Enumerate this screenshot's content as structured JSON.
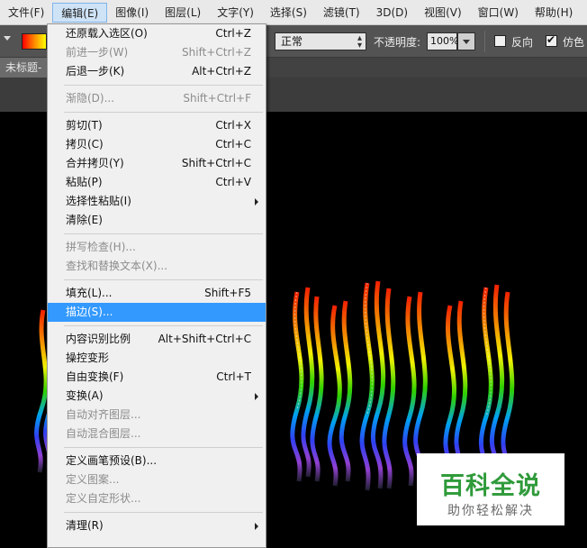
{
  "menubar": {
    "items": [
      "文件(F)",
      "编辑(E)",
      "图像(I)",
      "图层(L)",
      "文字(Y)",
      "选择(S)",
      "滤镜(T)",
      "3D(D)",
      "视图(V)",
      "窗口(W)",
      "帮助(H)"
    ],
    "active_index": 1
  },
  "options": {
    "mode_value": "正常",
    "opacity_label": "不透明度:",
    "opacity_value": "100%",
    "reverse_label": "反向",
    "reverse_checked": false,
    "dither_label": "仿色",
    "dither_checked": true
  },
  "doc_tab": {
    "title": "未标题-"
  },
  "edit_menu": {
    "groups": [
      [
        {
          "label": "还原载入选区(O)",
          "shortcut": "Ctrl+Z",
          "disabled": false
        },
        {
          "label": "前进一步(W)",
          "shortcut": "Shift+Ctrl+Z",
          "disabled": true
        },
        {
          "label": "后退一步(K)",
          "shortcut": "Alt+Ctrl+Z",
          "disabled": false
        }
      ],
      [
        {
          "label": "渐隐(D)...",
          "shortcut": "Shift+Ctrl+F",
          "disabled": true
        }
      ],
      [
        {
          "label": "剪切(T)",
          "shortcut": "Ctrl+X",
          "disabled": false
        },
        {
          "label": "拷贝(C)",
          "shortcut": "Ctrl+C",
          "disabled": false
        },
        {
          "label": "合并拷贝(Y)",
          "shortcut": "Shift+Ctrl+C",
          "disabled": false
        },
        {
          "label": "粘贴(P)",
          "shortcut": "Ctrl+V",
          "disabled": false
        },
        {
          "label": "选择性粘贴(I)",
          "shortcut": "",
          "disabled": false,
          "submenu": true
        },
        {
          "label": "清除(E)",
          "shortcut": "",
          "disabled": false
        }
      ],
      [
        {
          "label": "拼写检查(H)...",
          "shortcut": "",
          "disabled": true
        },
        {
          "label": "查找和替换文本(X)...",
          "shortcut": "",
          "disabled": true
        }
      ],
      [
        {
          "label": "填充(L)...",
          "shortcut": "Shift+F5",
          "disabled": false
        },
        {
          "label": "描边(S)...",
          "shortcut": "",
          "disabled": false,
          "highlight": true
        }
      ],
      [
        {
          "label": "内容识别比例",
          "shortcut": "Alt+Shift+Ctrl+C",
          "disabled": false
        },
        {
          "label": "操控变形",
          "shortcut": "",
          "disabled": false
        },
        {
          "label": "自由变换(F)",
          "shortcut": "Ctrl+T",
          "disabled": false
        },
        {
          "label": "变换(A)",
          "shortcut": "",
          "disabled": false,
          "submenu": true
        },
        {
          "label": "自动对齐图层...",
          "shortcut": "",
          "disabled": true
        },
        {
          "label": "自动混合图层...",
          "shortcut": "",
          "disabled": true
        }
      ],
      [
        {
          "label": "定义画笔预设(B)...",
          "shortcut": "",
          "disabled": false
        },
        {
          "label": "定义图案...",
          "shortcut": "",
          "disabled": true
        },
        {
          "label": "定义自定形状...",
          "shortcut": "",
          "disabled": true
        }
      ],
      [
        {
          "label": "清理(R)",
          "shortcut": "",
          "disabled": false,
          "submenu": true
        }
      ]
    ]
  },
  "watermark": {
    "title": "百科全说",
    "subtitle": "助你轻松解决"
  },
  "colors": {
    "menu_highlight": "#3399ff",
    "watermark_green": "#2f9a3a"
  }
}
